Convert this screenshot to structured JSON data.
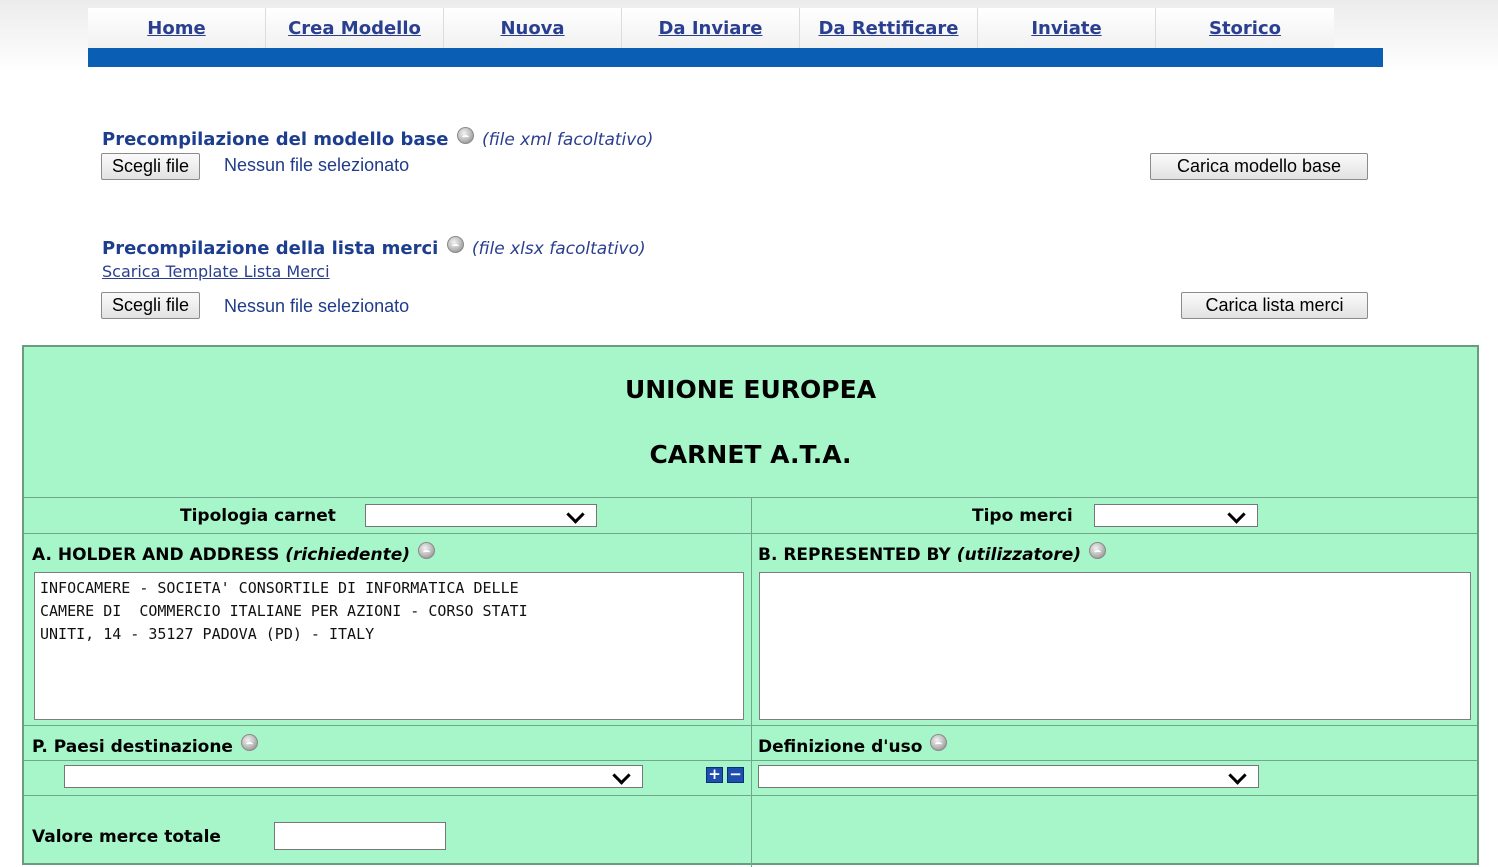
{
  "nav": {
    "items": [
      {
        "label": "Home"
      },
      {
        "label": "Crea Modello"
      },
      {
        "label": "Nuova"
      },
      {
        "label": "Da Inviare"
      },
      {
        "label": "Da Rettificare"
      },
      {
        "label": "Inviate"
      },
      {
        "label": "Storico"
      }
    ]
  },
  "upload_base": {
    "title": "Precompilazione del modello base",
    "hint": "(file xml facoltativo)",
    "choose_label": "Scegli file",
    "status": "Nessun file selezionato",
    "load_label": "Carica modello base"
  },
  "upload_goods": {
    "title": "Precompilazione della lista merci",
    "hint": "(file xlsx facoltativo)",
    "template_link": "Scarica Template Lista Merci",
    "choose_label": "Scegli file",
    "status": "Nessun file selezionato",
    "load_label": "Carica lista merci"
  },
  "form": {
    "heading1": "UNIONE EUROPEA",
    "heading2": "CARNET A.T.A.",
    "tipologia_label": "Tipologia carnet",
    "tipologia_value": "",
    "tipo_merci_label": "Tipo merci",
    "tipo_merci_value": "",
    "holder_label": "A. HOLDER AND ADDRESS",
    "holder_hint": "(richiedente)",
    "holder_value": "INFOCAMERE - SOCIETA' CONSORTILE DI INFORMATICA DELLE\nCAMERE DI  COMMERCIO ITALIANE PER AZIONI - CORSO STATI\nUNITI, 14 - 35127 PADOVA (PD) - ITALY",
    "represented_label": "B. REPRESENTED BY",
    "represented_hint": "(utilizzatore)",
    "represented_value": "",
    "paesi_label": "P. Paesi destinazione",
    "paesi_value": "",
    "uso_label": "Definizione d'uso",
    "uso_value": "",
    "valore_label": "Valore merce totale",
    "valore_value": "",
    "plus_symbol": "+",
    "minus_symbol": "−"
  },
  "icons": [
    "info-icon",
    "chevron-down-icon",
    "plus-icon",
    "minus-icon"
  ],
  "colors": {
    "nav_bar": "#0a5fb4",
    "link": "#2a3f8f",
    "panel": "#a7f6c9"
  }
}
